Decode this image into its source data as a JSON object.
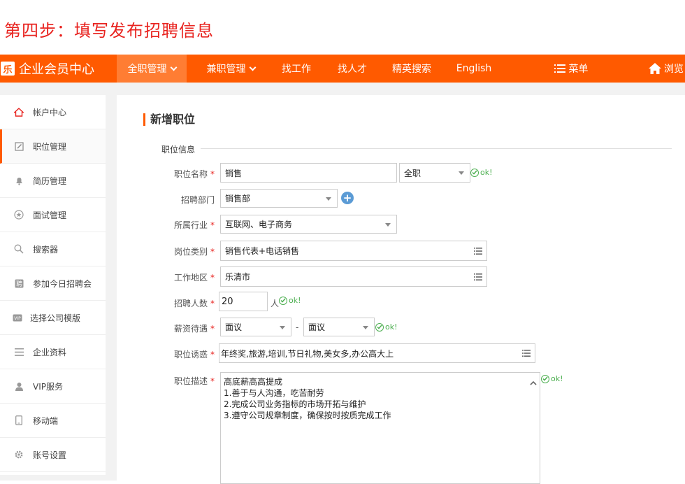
{
  "step_title": "第四步：填写发布招聘信息",
  "brand": {
    "logo_char": "乐",
    "name": "企业会员中心"
  },
  "nav": {
    "items": [
      {
        "label": "全职管理",
        "active": true,
        "caret": true
      },
      {
        "label": "兼职管理",
        "active": false,
        "caret": true
      },
      {
        "label": "找工作",
        "active": false,
        "caret": false
      },
      {
        "label": "找人才",
        "active": false,
        "caret": false
      },
      {
        "label": "精英搜索",
        "active": false,
        "caret": false
      },
      {
        "label": "English",
        "active": false,
        "caret": false
      }
    ],
    "menu_label": "菜单",
    "browse_label": "浏览"
  },
  "sidebar": {
    "items": [
      {
        "label": "帐户中心",
        "icon": "home-icon"
      },
      {
        "label": "职位管理",
        "icon": "edit-icon",
        "active": true
      },
      {
        "label": "简历管理",
        "icon": "bell-icon"
      },
      {
        "label": "面试管理",
        "icon": "star-icon"
      },
      {
        "label": "搜索器",
        "icon": "search-icon"
      },
      {
        "label": "参加今日招聘会",
        "icon": "recruit-icon"
      },
      {
        "label": "选择公司模版",
        "icon": "vip-template-icon"
      },
      {
        "label": "企业资料",
        "icon": "list-icon"
      },
      {
        "label": "VIP服务",
        "icon": "user-icon"
      },
      {
        "label": "移动端",
        "icon": "mobile-icon"
      },
      {
        "label": "账号设置",
        "icon": "gear-icon"
      }
    ]
  },
  "main": {
    "title": "新增职位",
    "section": "职位信息",
    "form": {
      "job_name": {
        "label": "职位名称",
        "value": "销售",
        "type_value": "全职",
        "ok": "ok!"
      },
      "department": {
        "label": "招聘部门",
        "value": "销售部"
      },
      "industry": {
        "label": "所属行业",
        "value": "互联网、电子商务"
      },
      "category": {
        "label": "岗位类别",
        "value": "销售代表+电话销售"
      },
      "location": {
        "label": "工作地区",
        "value": "乐清市"
      },
      "headcount": {
        "label": "招聘人数",
        "value": "20",
        "unit": "人",
        "ok": "ok!"
      },
      "salary": {
        "label": "薪资待遇",
        "min": "面议",
        "sep": "-",
        "max": "面议",
        "ok": "ok!"
      },
      "benefits": {
        "label": "职位诱惑",
        "value": "年终奖,旅游,培训,节日礼物,美女多,办公高大上"
      },
      "description": {
        "label": "职位描述",
        "value": "高底薪高高提成\n1.善于与人沟通，吃苦耐劳\n2.完成公司业务指标的市场开拓与维护\n3.遵守公司规章制度，确保按时按质完成工作",
        "ok": "ok!"
      }
    }
  }
}
